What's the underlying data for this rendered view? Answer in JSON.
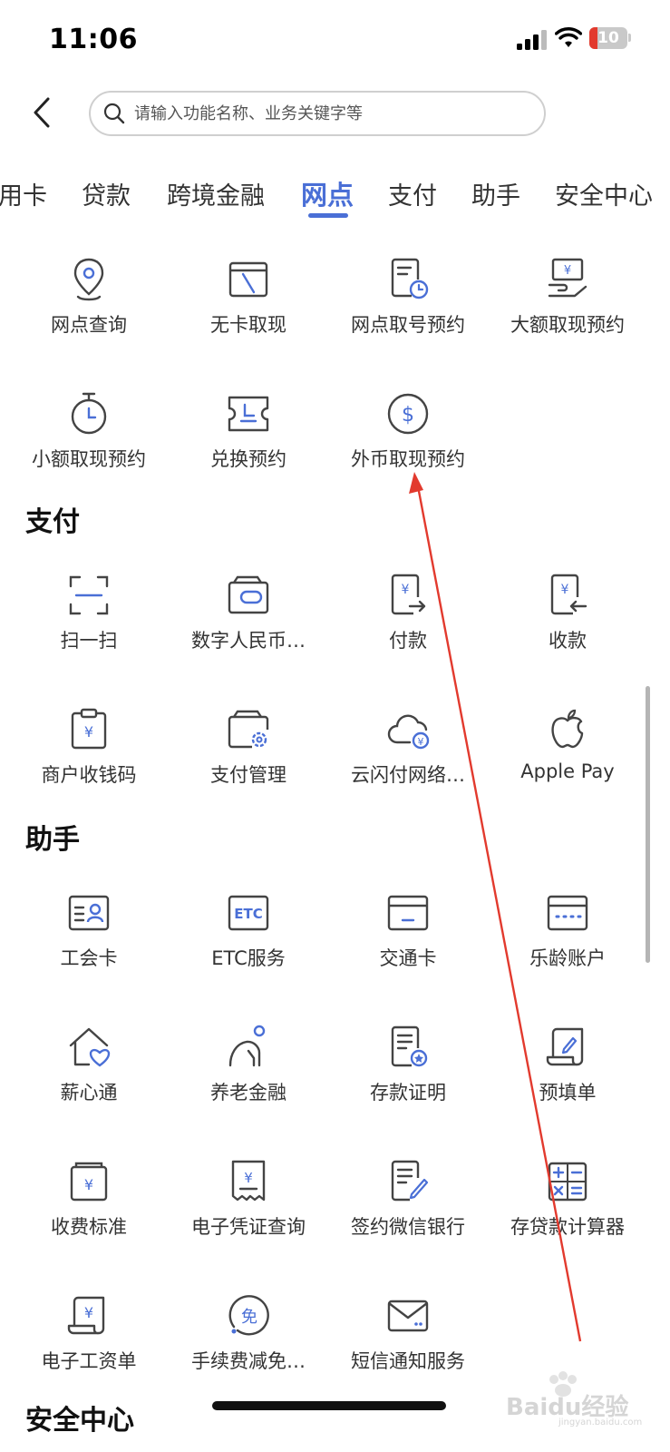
{
  "status_bar": {
    "time": "11:06",
    "battery_level": "10"
  },
  "search": {
    "placeholder": "请输入功能名称、业务关键字等"
  },
  "tabs": [
    {
      "label": "用卡"
    },
    {
      "label": "贷款"
    },
    {
      "label": "跨境金融"
    },
    {
      "label": "网点",
      "active": true
    },
    {
      "label": "支付"
    },
    {
      "label": "助手"
    },
    {
      "label": "安全中心"
    }
  ],
  "sections": {
    "branch": {
      "items": [
        {
          "label": "网点查询",
          "icon": "location-pin-icon"
        },
        {
          "label": "无卡取现",
          "icon": "card-slash-icon"
        },
        {
          "label": "网点取号预约",
          "icon": "ticket-clock-icon"
        },
        {
          "label": "大额取现预约",
          "icon": "hand-cash-icon"
        },
        {
          "label": "小额取现预约",
          "icon": "stopwatch-icon"
        },
        {
          "label": "兑换预约",
          "icon": "voucher-icon"
        },
        {
          "label": "外币取现预约",
          "icon": "dollar-coin-icon"
        }
      ]
    },
    "payment": {
      "title": "支付",
      "items": [
        {
          "label": "扫一扫",
          "icon": "scan-icon"
        },
        {
          "label": "数字人民币…",
          "icon": "digital-wallet-icon"
        },
        {
          "label": "付款",
          "icon": "pay-icon"
        },
        {
          "label": "收款",
          "icon": "receive-icon"
        },
        {
          "label": "商户收钱码",
          "icon": "merchant-qr-icon"
        },
        {
          "label": "支付管理",
          "icon": "wallet-gear-icon"
        },
        {
          "label": "云闪付网络…",
          "icon": "cloud-pay-icon"
        },
        {
          "label": "Apple Pay",
          "icon": "apple-icon"
        }
      ]
    },
    "assistant": {
      "title": "助手",
      "items": [
        {
          "label": "工会卡",
          "icon": "id-card-icon"
        },
        {
          "label": "ETC服务",
          "icon": "etc-icon"
        },
        {
          "label": "交通卡",
          "icon": "transit-card-icon"
        },
        {
          "label": "乐龄账户",
          "icon": "senior-card-icon"
        },
        {
          "label": "薪心通",
          "icon": "house-heart-icon"
        },
        {
          "label": "养老金融",
          "icon": "elder-icon"
        },
        {
          "label": "存款证明",
          "icon": "certificate-icon"
        },
        {
          "label": "预填单",
          "icon": "scroll-pen-icon"
        },
        {
          "label": "收费标准",
          "icon": "fee-book-icon"
        },
        {
          "label": "电子凭证查询",
          "icon": "receipt-icon"
        },
        {
          "label": "签约微信银行",
          "icon": "sign-doc-icon"
        },
        {
          "label": "存贷款计算器",
          "icon": "calculator-icon"
        },
        {
          "label": "电子工资单",
          "icon": "payslip-icon"
        },
        {
          "label": "手续费减免…",
          "icon": "fee-waiver-icon"
        },
        {
          "label": "短信通知服务",
          "icon": "envelope-icon"
        }
      ]
    },
    "security": {
      "title": "安全中心"
    }
  },
  "colors": {
    "accent": "#4a6fd6",
    "arrow": "#e23a2e"
  },
  "watermark": {
    "text": "Baidu经验",
    "subtext": "jingyan.baidu.com"
  }
}
